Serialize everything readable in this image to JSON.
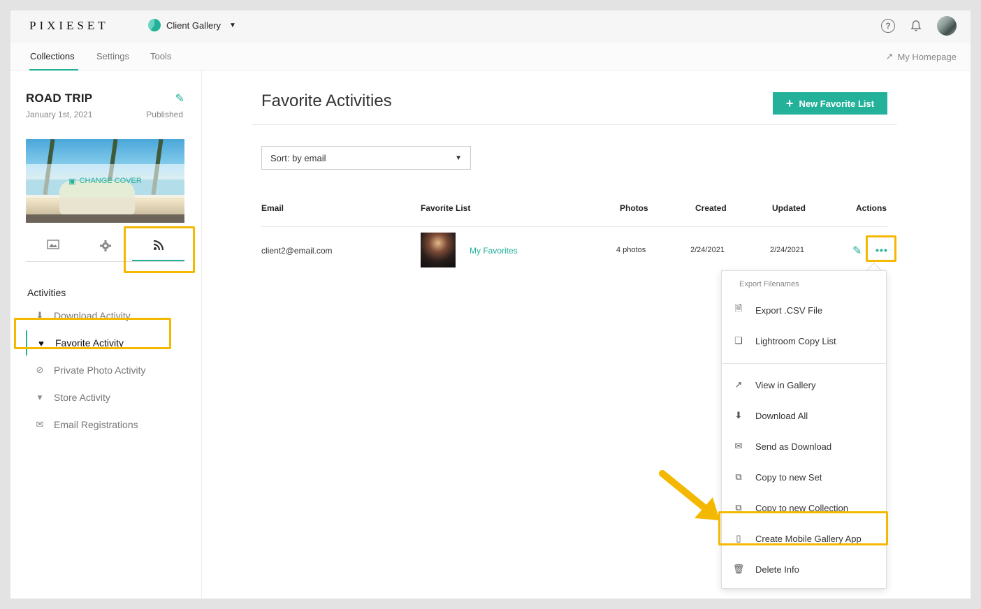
{
  "topbar": {
    "logo": "PIXIESET",
    "app_switch": "Client Gallery",
    "help_icon": "?"
  },
  "nav": {
    "tabs": [
      "Collections",
      "Settings",
      "Tools"
    ],
    "active_tab": "Collections",
    "my_homepage": "My Homepage"
  },
  "collection": {
    "title": "ROAD TRIP",
    "date": "January 1st, 2021",
    "status": "Published",
    "change_cover": "CHANGE COVER"
  },
  "activities": {
    "header": "Activities",
    "items": [
      {
        "label": "Download Activity",
        "icon": "download-icon"
      },
      {
        "label": "Favorite Activity",
        "icon": "heart-icon",
        "active": true
      },
      {
        "label": "Private Photo Activity",
        "icon": "eye-slash-icon"
      },
      {
        "label": "Store Activity",
        "icon": "cart-icon"
      },
      {
        "label": "Email Registrations",
        "icon": "envelope-icon"
      }
    ]
  },
  "main": {
    "title": "Favorite Activities",
    "new_button": "New Favorite List",
    "sort_label": "Sort: by email",
    "columns": [
      "Email",
      "Favorite List",
      "Photos",
      "Created",
      "Updated",
      "Actions"
    ],
    "rows": [
      {
        "email": "client2@email.com",
        "favorite_list": "My Favorites",
        "photos": "4 photos",
        "created": "2/24/2021",
        "updated": "2/24/2021"
      }
    ]
  },
  "menu": {
    "header": "Export Filenames",
    "export_items": [
      "Export .CSV File",
      "Lightroom Copy List"
    ],
    "items": [
      "View in Gallery",
      "Download All",
      "Send as Download",
      "Copy to new Set",
      "Copy to new Collection",
      "Create Mobile Gallery App",
      "Delete Info"
    ]
  },
  "colors": {
    "accent": "#23b199",
    "highlight": "#f5b800"
  }
}
